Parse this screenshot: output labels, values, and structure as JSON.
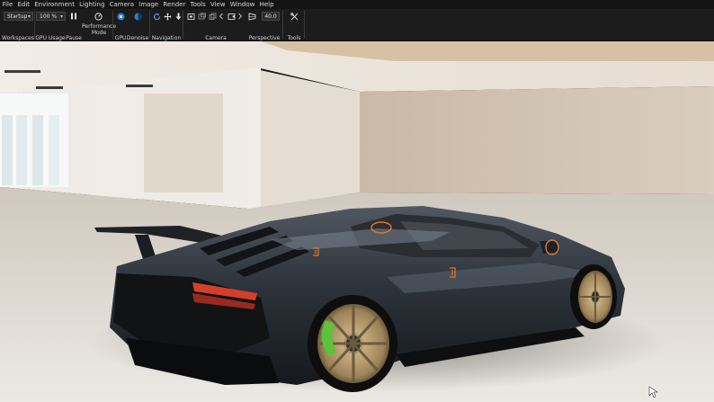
{
  "menu": [
    "File",
    "Edit",
    "Environment",
    "Lighting",
    "Camera",
    "Image",
    "Render",
    "Tools",
    "View",
    "Window",
    "Help"
  ],
  "toolbar": {
    "workspace_value": "Startup",
    "workspaces_label": "Workspaces",
    "gpu_usage_value": "100 %",
    "gpu_usage_label": "GPU Usage",
    "pause_label": "Pause",
    "performance_label_line1": "Performance",
    "performance_label_line2": "Mode",
    "gpu_label": "GPU",
    "denoise_label": "Denoise",
    "navigation_label": "Navigation",
    "camera_label": "Camera",
    "perspective_value": "40.0",
    "perspective_label": "Perspective",
    "tools_label": "Tools"
  },
  "colors": {
    "accent": "#2f7fd6",
    "car_body": "#2b3038",
    "wheel": "#b59a6c",
    "brake_caliper": "#5bc23a",
    "taillight": "#d2402c",
    "annotation": "#e07a2a"
  }
}
